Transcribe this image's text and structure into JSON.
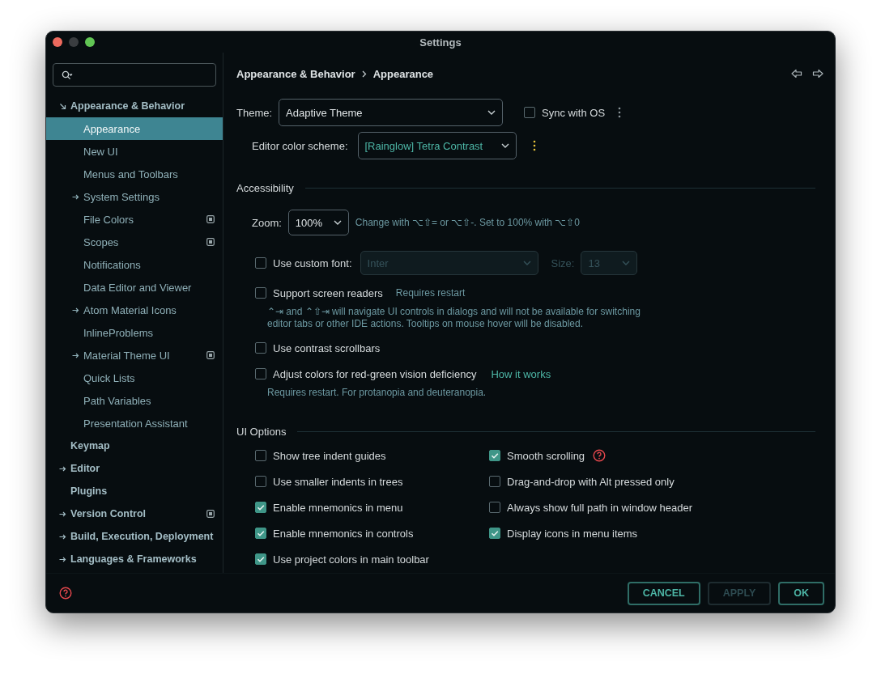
{
  "window": {
    "title": "Settings"
  },
  "sidebar": {
    "items": [
      {
        "label": "Appearance & Behavior",
        "expanded": true,
        "selected": false,
        "modified": false,
        "children": [
          {
            "label": "Appearance",
            "selected": true,
            "modified": false
          },
          {
            "label": "New UI",
            "selected": false,
            "modified": false
          },
          {
            "label": "Menus and Toolbars",
            "selected": false,
            "modified": false
          },
          {
            "label": "System Settings",
            "expanded": false,
            "selected": false,
            "modified": false
          },
          {
            "label": "File Colors",
            "selected": false,
            "modified": true
          },
          {
            "label": "Scopes",
            "selected": false,
            "modified": true
          },
          {
            "label": "Notifications",
            "selected": false,
            "modified": false
          },
          {
            "label": "Data Editor and Viewer",
            "selected": false,
            "modified": false
          },
          {
            "label": "Atom Material Icons",
            "expanded": false,
            "selected": false,
            "modified": false
          },
          {
            "label": "InlineProblems",
            "selected": false,
            "modified": false
          },
          {
            "label": "Material Theme UI",
            "expanded": false,
            "selected": false,
            "modified": true
          },
          {
            "label": "Quick Lists",
            "selected": false,
            "modified": false
          },
          {
            "label": "Path Variables",
            "selected": false,
            "modified": false
          },
          {
            "label": "Presentation Assistant",
            "selected": false,
            "modified": false
          }
        ]
      },
      {
        "label": "Keymap",
        "selected": false,
        "modified": false
      },
      {
        "label": "Editor",
        "expanded": false,
        "selected": false,
        "modified": false
      },
      {
        "label": "Plugins",
        "selected": false,
        "modified": false
      },
      {
        "label": "Version Control",
        "expanded": false,
        "selected": false,
        "modified": true
      },
      {
        "label": "Build, Execution, Deployment",
        "expanded": false,
        "selected": false,
        "modified": false
      },
      {
        "label": "Languages & Frameworks",
        "expanded": false,
        "selected": false,
        "modified": false
      }
    ]
  },
  "breadcrumb": [
    "Appearance & Behavior",
    "Appearance"
  ],
  "theme": {
    "label": "Theme:",
    "value": "Adaptive Theme",
    "sync": {
      "label": "Sync with OS",
      "checked": false
    }
  },
  "color_scheme": {
    "label": "Editor color scheme:",
    "value": "[Rainglow] Tetra Contrast"
  },
  "accessibility": {
    "title": "Accessibility",
    "zoom": {
      "label": "Zoom:",
      "value": "100%",
      "hint": "Change with ⌥⇧= or ⌥⇧-. Set to 100% with ⌥⇧0"
    },
    "custom_font": {
      "label": "Use custom font:",
      "checked": false,
      "font": {
        "value": "Inter",
        "disabled": true
      },
      "size": {
        "label": "Size:",
        "value": "13",
        "disabled": true
      }
    },
    "options": [
      {
        "label": "Support screen readers",
        "checked": false,
        "note": "Requires restart",
        "description": "⌃⇥ and ⌃⇧⇥ will navigate UI controls in dialogs and will not be available for switching editor tabs or other IDE actions. Tooltips on mouse hover will be disabled."
      },
      {
        "label": "Use contrast scrollbars",
        "checked": false
      },
      {
        "label": "Adjust colors for red-green vision deficiency",
        "checked": false,
        "link": "How it works",
        "description": "Requires restart. For protanopia and deuteranopia."
      }
    ]
  },
  "ui_options": {
    "title": "UI Options",
    "left": [
      {
        "label": "Show tree indent guides",
        "checked": false
      },
      {
        "label": "Use smaller indents in trees",
        "checked": false
      },
      {
        "label": "Enable mnemonics in menu",
        "checked": true
      },
      {
        "label": "Enable mnemonics in controls",
        "checked": true
      },
      {
        "label": "Use project colors in main toolbar",
        "checked": true
      }
    ],
    "right": [
      {
        "label": "Smooth scrolling",
        "checked": true,
        "help": true
      },
      {
        "label": "Drag-and-drop with Alt pressed only",
        "checked": false
      },
      {
        "label": "Always show full path in window header",
        "checked": false
      },
      {
        "label": "Display icons in menu items",
        "checked": true
      }
    ]
  },
  "buttons": [
    {
      "label": "CANCEL",
      "disabled": false
    },
    {
      "label": "APPLY",
      "disabled": true
    },
    {
      "label": "OK",
      "disabled": false
    }
  ]
}
